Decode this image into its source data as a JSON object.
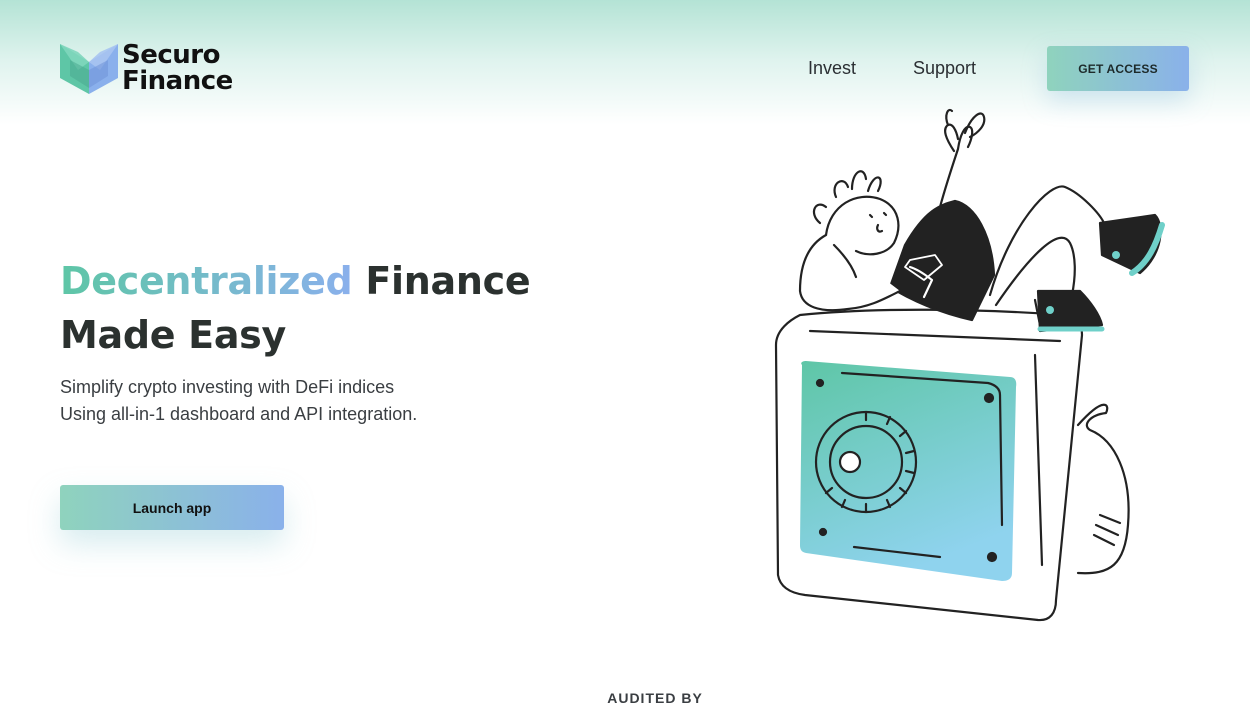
{
  "brand": {
    "name_line1": "Securo",
    "name_line2": "Finance"
  },
  "nav": {
    "invest": "Invest",
    "support": "Support",
    "get_access": "GET ACCESS"
  },
  "hero": {
    "title_highlight": "Decentralized",
    "title_rest_1": " Finance",
    "title_line2": "Made Easy",
    "subtitle_line1": "Simplify crypto investing with DeFi indices",
    "subtitle_line2": "Using all-in-1 dashboard and API integration.",
    "cta": "Launch app"
  },
  "audited": {
    "label": "AUDITED BY"
  },
  "icons": {
    "logo": "securo-logo-icon",
    "illustration": "person-on-safe-illustration"
  },
  "colors": {
    "accent_green": "#5ec6a6",
    "accent_blue": "#8ab0ec",
    "text_dark": "#2b312f"
  }
}
